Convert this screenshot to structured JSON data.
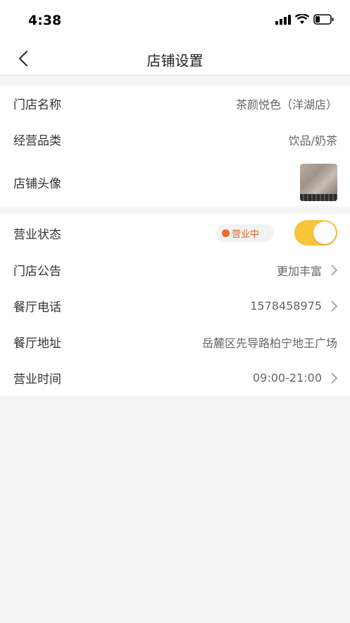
{
  "status_bar": {
    "time": "4:38"
  },
  "header": {
    "title": "店铺设置"
  },
  "basic_section": {
    "store_name": {
      "label": "门店名称",
      "value": "茶颜悦色（洋湖店）"
    },
    "category": {
      "label": "经营品类",
      "value": "饮品/奶茶"
    },
    "avatar": {
      "label": "店铺头像"
    }
  },
  "business_section": {
    "status": {
      "label": "营业状态",
      "badge": "营业中",
      "toggle_on": true
    },
    "notice": {
      "label": "门店公告",
      "value": "更加丰富"
    },
    "phone": {
      "label": "餐厅电话",
      "value": "1578458975"
    },
    "address": {
      "label": "餐厅地址",
      "value": "岳麓区先导路柏宁地王广场"
    },
    "hours": {
      "label": "营业时间",
      "value": "09:00-21:00"
    }
  },
  "colors": {
    "accent": "#f7c43a",
    "status_badge": "#e3612b"
  }
}
